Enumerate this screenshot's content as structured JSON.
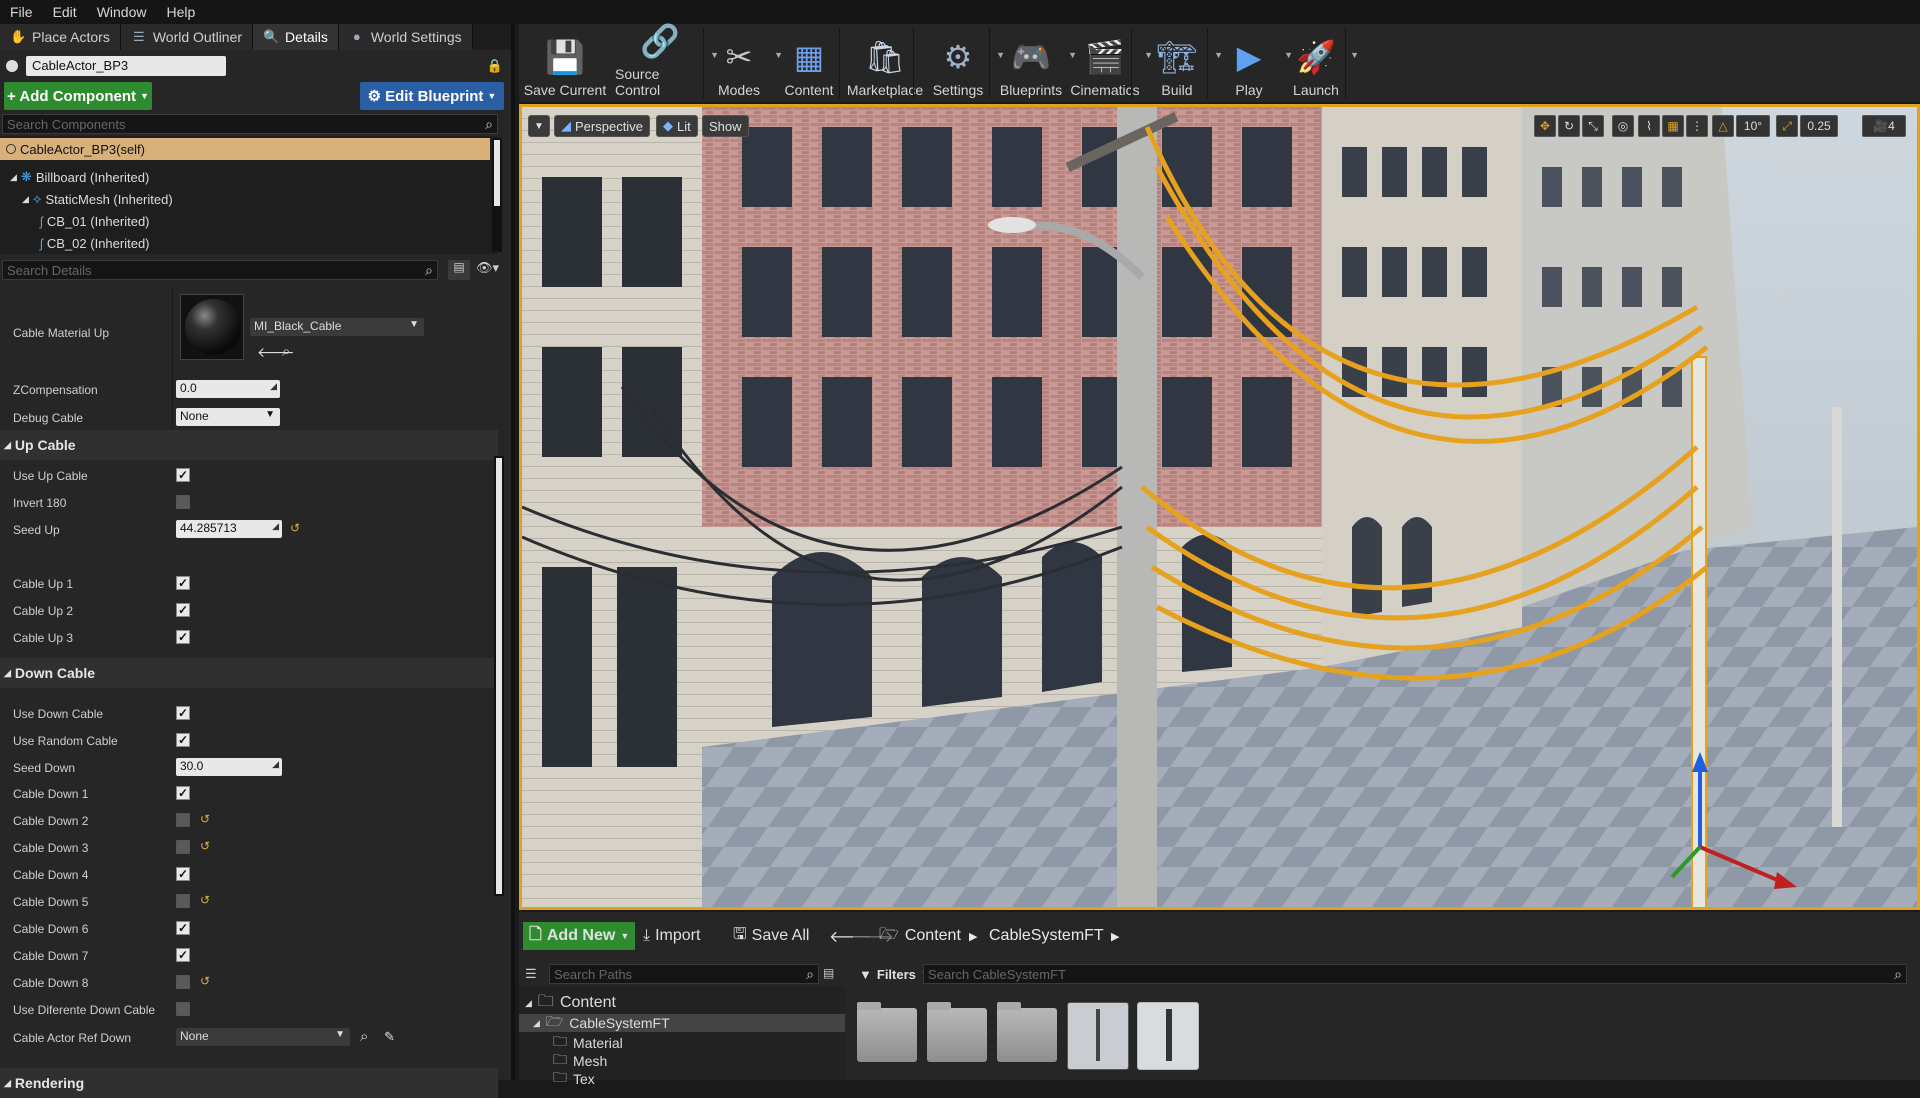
{
  "menu": [
    "File",
    "Edit",
    "Window",
    "Help"
  ],
  "left_tabs": [
    {
      "label": "Place Actors",
      "icon": "place-actors-icon"
    },
    {
      "label": "World Outliner",
      "icon": "outliner-icon"
    },
    {
      "label": "Details",
      "icon": "details-icon"
    },
    {
      "label": "World Settings",
      "icon": "globe-icon"
    }
  ],
  "actor_name": "CableActor_BP3",
  "add_component": "+ Add Component",
  "edit_blueprint": "Edit Blueprint",
  "search_components_placeholder": "Search Components",
  "components": [
    {
      "label": "CableActor_BP3(self)",
      "selected": true
    },
    {
      "label": "Billboard (Inherited)"
    },
    {
      "label": "StaticMesh (Inherited)"
    },
    {
      "label": "CB_01 (Inherited)"
    },
    {
      "label": "CB_02 (Inherited)"
    }
  ],
  "search_details_placeholder": "Search Details",
  "material": {
    "label": "Cable Material Up",
    "value": "MI_Black_Cable"
  },
  "zcomp": {
    "label": "ZCompensation",
    "value": "0.0"
  },
  "debug_cable": {
    "label": "Debug Cable",
    "value": "None"
  },
  "up_cable": {
    "title": "Up Cable",
    "use": "Use Up Cable",
    "invert": "Invert 180",
    "seed_label": "Seed Up",
    "seed_value": "44.285713",
    "c1": "Cable Up 1",
    "c2": "Cable Up 2",
    "c3": "Cable Up 3"
  },
  "down_cable": {
    "title": "Down Cable",
    "use": "Use Down Cable",
    "random": "Use Random Cable",
    "seed_label": "Seed Down",
    "seed_value": "30.0",
    "cables": [
      "Cable Down 1",
      "Cable Down 2",
      "Cable Down 3",
      "Cable Down 4",
      "Cable Down 5",
      "Cable Down 6",
      "Cable Down 7",
      "Cable Down 8"
    ],
    "checked": [
      true,
      false,
      false,
      true,
      false,
      true,
      true,
      false
    ],
    "diff": "Use Diferente Down Cable",
    "ref_label": "Cable Actor Ref Down",
    "ref_value": "None"
  },
  "rendering": "Rendering",
  "toolbar": [
    "Save Current",
    "Source Control",
    "Modes",
    "Content",
    "Marketplace",
    "Settings",
    "Blueprints",
    "Cinematics",
    "Build",
    "Play",
    "Launch"
  ],
  "viewport": {
    "perspective": "Perspective",
    "lit": "Lit",
    "show": "Show",
    "angle": "10°",
    "scale": "0.25",
    "speed": "4"
  },
  "browser": {
    "add_new": "Add New",
    "import": "Import",
    "save_all": "Save All",
    "crumbs": [
      "Content",
      "CableSystemFT"
    ],
    "search_paths": "Search Paths",
    "filters": "Filters",
    "search_assets": "Search CableSystemFT",
    "folders": [
      "Content",
      "CableSystemFT",
      "Material",
      "Mesh",
      "Tex"
    ]
  },
  "colors": {
    "accent": "#e0a020",
    "green": "#2f8b2f",
    "blue": "#2a5fa5",
    "cable": "#e6a21e"
  }
}
